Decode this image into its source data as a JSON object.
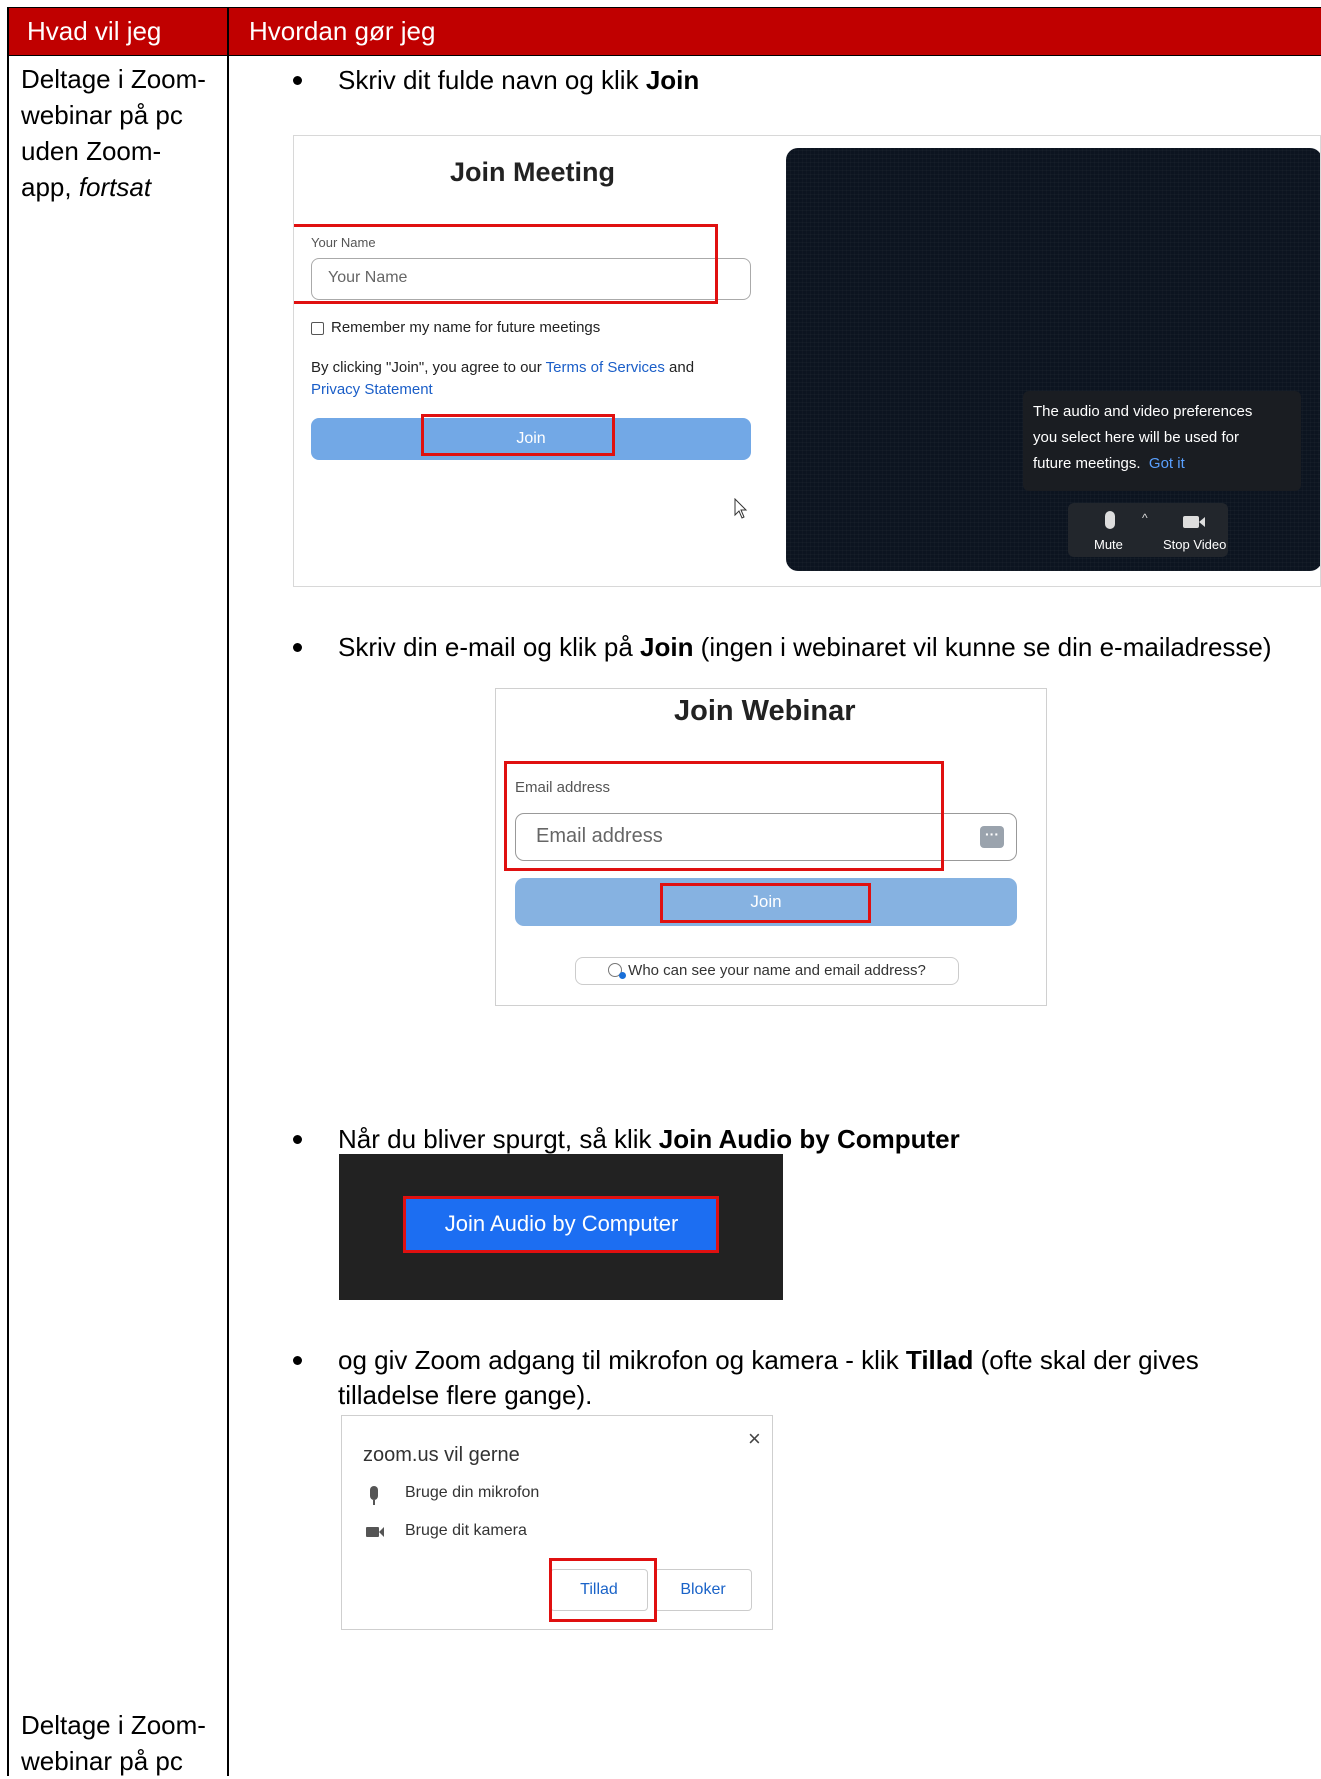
{
  "table": {
    "header": {
      "col1": "Hvad vil jeg",
      "col2": "Hvordan gør jeg"
    },
    "row1_left": {
      "line1": "Deltage i Zoom-",
      "line2": "webinar på pc",
      "line3": "uden Zoom-",
      "line4_plain": "app, ",
      "line4_italic": "fortsat"
    },
    "row2_left": {
      "line1": "Deltage i Zoom-",
      "line2": "webinar på pc"
    }
  },
  "steps": [
    {
      "text_before": "Skriv dit fulde navn og klik ",
      "bold": "Join",
      "text_after": ""
    },
    {
      "text_before": "Skriv din e-mail og klik på ",
      "bold": "Join",
      "text_after": " (ingen i webinaret vil kunne se din e-mailadresse)"
    },
    {
      "text_before": "Når du bliver spurgt, så klik ",
      "bold": "Join Audio by Computer",
      "text_after": ""
    },
    {
      "text_before": "og giv Zoom adgang til mikrofon og kamera - klik ",
      "bold": "Tillad",
      "text_after": " (ofte skal der gives",
      "line2": "tilladelse flere gange)."
    }
  ],
  "join_meeting": {
    "title": "Join Meeting",
    "name_label": "Your Name",
    "name_placeholder": "Your Name",
    "remember_label": "Remember my name for future meetings",
    "terms_prefix": "By clicking \"Join\", you agree to our ",
    "terms_link": "Terms of Services",
    "terms_and": " and",
    "privacy_link": "Privacy Statement",
    "join_label": "Join",
    "tooltip_line1": "The audio and video preferences",
    "tooltip_line2": "you select here will be used for",
    "tooltip_line3": "future meetings.",
    "tooltip_link": "Got it",
    "mute_label": "Mute",
    "stop_video_label": "Stop Video"
  },
  "join_webinar": {
    "title": "Join Webinar",
    "email_label": "Email address",
    "email_placeholder": "Email address",
    "join_label": "Join",
    "who_can_see": "Who can see your name and email address?"
  },
  "audio_dialog": {
    "button_label": "Join Audio by Computer"
  },
  "permission_dialog": {
    "title": "zoom.us vil gerne",
    "mic_label": "Bruge din mikrofon",
    "camera_label": "Bruge dit kamera",
    "allow_label": "Tillad",
    "block_label": "Bloker",
    "close_glyph": "×"
  },
  "colors": {
    "header_bg": "#c00000",
    "highlight": "#e01010",
    "zoom_blue": "#1c6ef2"
  }
}
